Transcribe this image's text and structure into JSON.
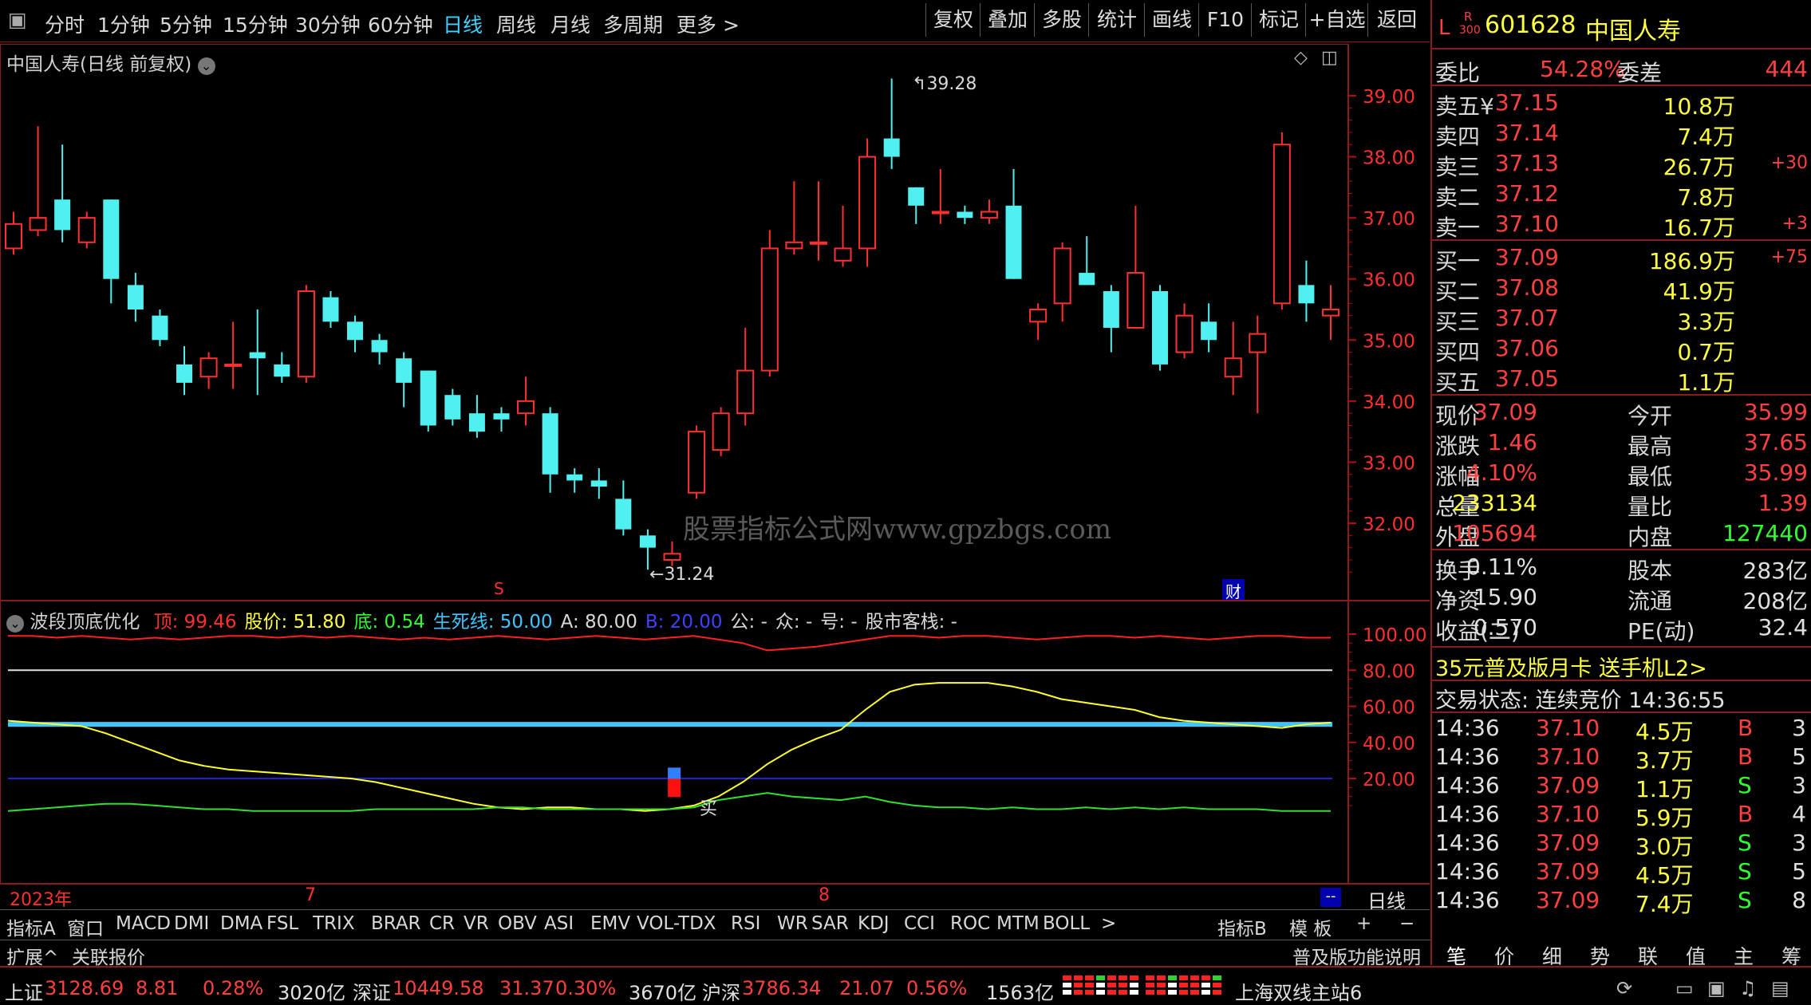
{
  "toolbar": {
    "periods": [
      "分时",
      "1分钟",
      "5分钟",
      "15分钟",
      "30分钟",
      "60分钟",
      "日线",
      "周线",
      "月线",
      "多周期",
      "更多 >"
    ],
    "active_period": "日线",
    "right_buttons": [
      "复权",
      "叠加",
      "多股",
      "统计",
      "画线",
      "F10",
      "标记",
      "+自选",
      "返回"
    ]
  },
  "chart": {
    "title": "中国人寿(日线 前复权)",
    "price_high_label": "39.28",
    "price_low_label": "31.24",
    "watermark": "股票指标公式网www.gpzbgs.com",
    "marker_s": "S",
    "marker_cai": "财",
    "price_axis": [
      "39.00",
      "38.00",
      "37.00",
      "36.00",
      "35.00",
      "34.00",
      "33.00",
      "32.00"
    ]
  },
  "indicator": {
    "name": "波段顶底优化",
    "labels": [
      {
        "text": "顶: 99.46",
        "color": "#ff3030"
      },
      {
        "text": "股价: 51.80",
        "color": "#ffff40"
      },
      {
        "text": "底: 0.54",
        "color": "#30ff30"
      },
      {
        "text": "生死线: 50.00",
        "color": "#3fc6ff"
      },
      {
        "text": "A: 80.00",
        "color": "#d8d8d8"
      },
      {
        "text": "B: 20.00",
        "color": "#4040ff"
      },
      {
        "text": "公: -",
        "color": "#d8d8d8"
      },
      {
        "text": "众: -",
        "color": "#d8d8d8"
      },
      {
        "text": "号: -",
        "color": "#d8d8d8"
      },
      {
        "text": "股市客栈: -",
        "color": "#d8d8d8"
      }
    ],
    "axis": [
      "100.00",
      "80.00",
      "60.00",
      "40.00",
      "20.00"
    ],
    "buy_label": "买"
  },
  "chart_data": {
    "type": "candlestick",
    "title": "中国人寿(日线 前复权)",
    "ylim": [
      31.5,
      39.5
    ],
    "x_labels": [
      "2023年",
      "7",
      "8"
    ],
    "candles": [
      {
        "o": 36.5,
        "c": 36.9,
        "h": 37.1,
        "l": 36.4
      },
      {
        "o": 36.8,
        "c": 37.0,
        "h": 38.5,
        "l": 36.7
      },
      {
        "o": 37.3,
        "c": 36.8,
        "h": 38.2,
        "l": 36.6
      },
      {
        "o": 36.6,
        "c": 37.0,
        "h": 37.1,
        "l": 36.5
      },
      {
        "o": 37.3,
        "c": 36.0,
        "h": 37.3,
        "l": 35.6
      },
      {
        "o": 35.9,
        "c": 35.5,
        "h": 36.1,
        "l": 35.3
      },
      {
        "o": 35.4,
        "c": 35.0,
        "h": 35.5,
        "l": 34.9
      },
      {
        "o": 34.6,
        "c": 34.3,
        "h": 34.9,
        "l": 34.1
      },
      {
        "o": 34.4,
        "c": 34.7,
        "h": 34.8,
        "l": 34.2
      },
      {
        "o": 34.6,
        "c": 34.6,
        "h": 35.3,
        "l": 34.2
      },
      {
        "o": 34.8,
        "c": 34.7,
        "h": 35.5,
        "l": 34.1
      },
      {
        "o": 34.6,
        "c": 34.4,
        "h": 34.8,
        "l": 34.3
      },
      {
        "o": 34.4,
        "c": 35.8,
        "h": 35.9,
        "l": 34.3
      },
      {
        "o": 35.7,
        "c": 35.3,
        "h": 35.8,
        "l": 35.2
      },
      {
        "o": 35.3,
        "c": 35.0,
        "h": 35.4,
        "l": 34.8
      },
      {
        "o": 35.0,
        "c": 34.8,
        "h": 35.1,
        "l": 34.6
      },
      {
        "o": 34.7,
        "c": 34.3,
        "h": 34.8,
        "l": 33.9
      },
      {
        "o": 34.5,
        "c": 33.6,
        "h": 34.5,
        "l": 33.5
      },
      {
        "o": 34.1,
        "c": 33.7,
        "h": 34.2,
        "l": 33.6
      },
      {
        "o": 33.8,
        "c": 33.5,
        "h": 34.1,
        "l": 33.4
      },
      {
        "o": 33.8,
        "c": 33.7,
        "h": 33.9,
        "l": 33.5
      },
      {
        "o": 33.8,
        "c": 34.0,
        "h": 34.4,
        "l": 33.6
      },
      {
        "o": 33.8,
        "c": 32.8,
        "h": 33.9,
        "l": 32.5
      },
      {
        "o": 32.8,
        "c": 32.7,
        "h": 32.9,
        "l": 32.5
      },
      {
        "o": 32.7,
        "c": 32.6,
        "h": 32.9,
        "l": 32.4
      },
      {
        "o": 32.4,
        "c": 31.9,
        "h": 32.7,
        "l": 31.8
      },
      {
        "o": 31.8,
        "c": 31.6,
        "h": 31.9,
        "l": 31.24
      },
      {
        "o": 31.4,
        "c": 31.5,
        "h": 31.7,
        "l": 31.3
      },
      {
        "o": 32.5,
        "c": 33.5,
        "h": 33.6,
        "l": 32.4
      },
      {
        "o": 33.2,
        "c": 33.8,
        "h": 33.9,
        "l": 33.1
      },
      {
        "o": 33.8,
        "c": 34.5,
        "h": 35.2,
        "l": 33.6
      },
      {
        "o": 34.5,
        "c": 36.5,
        "h": 36.8,
        "l": 34.4
      },
      {
        "o": 36.5,
        "c": 36.6,
        "h": 37.6,
        "l": 36.4
      },
      {
        "o": 36.6,
        "c": 36.6,
        "h": 37.6,
        "l": 36.3
      },
      {
        "o": 36.3,
        "c": 36.5,
        "h": 37.2,
        "l": 36.2
      },
      {
        "o": 36.5,
        "c": 38.0,
        "h": 38.3,
        "l": 36.2
      },
      {
        "o": 38.3,
        "c": 38.0,
        "h": 39.28,
        "l": 37.8
      },
      {
        "o": 37.5,
        "c": 37.2,
        "h": 37.5,
        "l": 36.9
      },
      {
        "o": 37.1,
        "c": 37.1,
        "h": 37.8,
        "l": 36.9
      },
      {
        "o": 37.1,
        "c": 37.0,
        "h": 37.2,
        "l": 36.9
      },
      {
        "o": 37.0,
        "c": 37.1,
        "h": 37.3,
        "l": 36.9
      },
      {
        "o": 37.2,
        "c": 36.0,
        "h": 37.8,
        "l": 36.0
      },
      {
        "o": 35.3,
        "c": 35.5,
        "h": 35.6,
        "l": 35.0
      },
      {
        "o": 35.6,
        "c": 36.5,
        "h": 36.6,
        "l": 35.3
      },
      {
        "o": 36.1,
        "c": 35.9,
        "h": 36.7,
        "l": 35.9
      },
      {
        "o": 35.8,
        "c": 35.2,
        "h": 35.9,
        "l": 34.8
      },
      {
        "o": 35.2,
        "c": 36.1,
        "h": 37.2,
        "l": 35.2
      },
      {
        "o": 35.8,
        "c": 34.6,
        "h": 35.9,
        "l": 34.5
      },
      {
        "o": 34.8,
        "c": 35.4,
        "h": 35.6,
        "l": 34.7
      },
      {
        "o": 35.3,
        "c": 35.0,
        "h": 35.6,
        "l": 34.8
      },
      {
        "o": 34.4,
        "c": 34.7,
        "h": 35.3,
        "l": 34.1
      },
      {
        "o": 34.8,
        "c": 35.1,
        "h": 35.4,
        "l": 33.8
      },
      {
        "o": 35.6,
        "c": 38.2,
        "h": 38.4,
        "l": 35.5
      },
      {
        "o": 35.9,
        "c": 35.6,
        "h": 36.3,
        "l": 35.3
      },
      {
        "o": 35.4,
        "c": 35.5,
        "h": 35.9,
        "l": 35.0
      }
    ],
    "indicator_series": {
      "ylim": [
        0,
        105
      ],
      "top_red": [
        99,
        99,
        98,
        99,
        98,
        97,
        98,
        97,
        98,
        99,
        99,
        98,
        99,
        98,
        99,
        98,
        97,
        98,
        97,
        98,
        99,
        98,
        97,
        98,
        99,
        98,
        97,
        98,
        99,
        97,
        95,
        91,
        92,
        93,
        95,
        97,
        99,
        99,
        98,
        99,
        99,
        98,
        97,
        98,
        99,
        99,
        98,
        99,
        98,
        97,
        98,
        99,
        99,
        98,
        98
      ],
      "price_yellow": [
        52,
        51,
        50,
        49,
        45,
        40,
        35,
        30,
        27,
        25,
        24,
        23,
        22,
        21,
        20,
        18,
        15,
        12,
        9,
        6,
        4,
        3,
        4,
        4,
        3,
        3,
        2,
        3,
        5,
        10,
        18,
        28,
        36,
        42,
        47,
        58,
        68,
        72,
        73,
        73,
        73,
        71,
        68,
        64,
        62,
        60,
        58,
        54,
        52,
        51,
        50,
        49,
        48,
        50,
        51
      ],
      "bottom_green": [
        2,
        3,
        4,
        5,
        6,
        6,
        5,
        4,
        3,
        3,
        2,
        2,
        2,
        2,
        2,
        3,
        3,
        3,
        3,
        3,
        4,
        4,
        3,
        3,
        3,
        3,
        3,
        3,
        4,
        8,
        10,
        12,
        10,
        9,
        8,
        10,
        7,
        5,
        4,
        4,
        3,
        4,
        3,
        3,
        4,
        3,
        4,
        3,
        4,
        3,
        3,
        3,
        2,
        2,
        2
      ],
      "A": 80,
      "B": 20,
      "shengsi": 50,
      "buy_index": 27,
      "buy_value": 26
    }
  },
  "bottom_axis": {
    "labels": [
      "2023年",
      "7",
      "8"
    ],
    "period": "日线"
  },
  "indicator_tabs": [
    "指标A",
    "窗口",
    "MACD",
    "DMI",
    "DMA",
    "FSL",
    "TRIX",
    "BRAR",
    "CR",
    "VR",
    "OBV",
    "ASI",
    "EMV",
    "VOL-TDX",
    "RSI",
    "WR",
    "SAR",
    "KDJ",
    "CCI",
    "ROC",
    "MTM",
    "BOLL",
    ">"
  ],
  "indicator_tabs_right": [
    "指标B",
    "模 板",
    "+",
    "−"
  ],
  "bar2": {
    "left": [
      "扩展^",
      "关联报价"
    ],
    "right": "普及版功能说明"
  },
  "right_panel": {
    "flag_L": "L",
    "flag_R": "R",
    "flag_300": "300",
    "code": "601628",
    "name": "中国人寿",
    "weibi_label": "委比",
    "weibi": "54.28%",
    "weicha_label": "委差",
    "weicha": "444",
    "sell": [
      {
        "label": "卖五¥",
        "price": "37.15",
        "vol": "10.8万",
        "delta": ""
      },
      {
        "label": "卖四",
        "price": "37.14",
        "vol": "7.4万",
        "delta": ""
      },
      {
        "label": "卖三",
        "price": "37.13",
        "vol": "26.7万",
        "delta": "+30"
      },
      {
        "label": "卖二",
        "price": "37.12",
        "vol": "7.8万",
        "delta": ""
      },
      {
        "label": "卖一",
        "price": "37.10",
        "vol": "16.7万",
        "delta": "+3"
      }
    ],
    "buy": [
      {
        "label": "买一",
        "price": "37.09",
        "vol": "186.9万",
        "delta": "+75"
      },
      {
        "label": "买二",
        "price": "37.08",
        "vol": "41.9万",
        "delta": ""
      },
      {
        "label": "买三",
        "price": "37.07",
        "vol": "3.3万",
        "delta": ""
      },
      {
        "label": "买四",
        "price": "37.06",
        "vol": "0.7万",
        "delta": ""
      },
      {
        "label": "买五",
        "price": "37.05",
        "vol": "1.1万",
        "delta": ""
      }
    ],
    "quotes": [
      {
        "l1": "现价",
        "v1": "37.09",
        "c1": "red",
        "l2": "今开",
        "v2": "35.99",
        "c2": "red"
      },
      {
        "l1": "涨跌",
        "v1": "1.46",
        "c1": "red",
        "l2": "最高",
        "v2": "37.65",
        "c2": "red"
      },
      {
        "l1": "涨幅",
        "v1": "4.10%",
        "c1": "red",
        "l2": "最低",
        "v2": "35.99",
        "c2": "red"
      },
      {
        "l1": "总量",
        "v1": "233134",
        "c1": "yel",
        "l2": "量比",
        "v2": "1.39",
        "c2": "red"
      },
      {
        "l1": "外盘",
        "v1": "105694",
        "c1": "red",
        "l2": "内盘",
        "v2": "127440",
        "c2": "grn"
      }
    ],
    "quotes2": [
      {
        "l1": "换手",
        "v1": "0.11%",
        "c1": "wht",
        "l2": "股本",
        "v2": "283亿",
        "c2": "wht"
      },
      {
        "l1": "净资",
        "v1": "15.90",
        "c1": "wht",
        "l2": "流通",
        "v2": "208亿",
        "c2": "wht"
      },
      {
        "l1": "收益(二)",
        "v1": "0.570",
        "c1": "wht",
        "l2": "PE(动)",
        "v2": "32.4",
        "c2": "wht"
      }
    ],
    "promo": "35元普及版月卡 送手机L2>",
    "trade_status": "交易状态: 连续竞价 14:36:55",
    "ticks": [
      {
        "t": "14:36",
        "p": "37.10",
        "v": "4.5万",
        "f": "B",
        "n": "3"
      },
      {
        "t": "14:36",
        "p": "37.10",
        "v": "3.7万",
        "f": "B",
        "n": "5"
      },
      {
        "t": "14:36",
        "p": "37.09",
        "v": "1.1万",
        "f": "S",
        "n": "3"
      },
      {
        "t": "14:36",
        "p": "37.10",
        "v": "5.9万",
        "f": "B",
        "n": "4"
      },
      {
        "t": "14:36",
        "p": "37.09",
        "v": "3.0万",
        "f": "S",
        "n": "3"
      },
      {
        "t": "14:36",
        "p": "37.09",
        "v": "4.5万",
        "f": "S",
        "n": "5"
      },
      {
        "t": "14:36",
        "p": "37.09",
        "v": "7.4万",
        "f": "S",
        "n": "8"
      }
    ],
    "tabs": [
      "笔",
      "价",
      "细",
      "势",
      "联",
      "值",
      "主",
      "筹"
    ]
  },
  "status": [
    {
      "text": "上证",
      "color": "#e0e0e0"
    },
    {
      "text": "3128.69",
      "color": "#ff4040"
    },
    {
      "text": "8.81",
      "color": "#ff4040"
    },
    {
      "text": "0.28%",
      "color": "#ff4040"
    },
    {
      "text": "3020亿",
      "color": "#e0e0e0"
    },
    {
      "text": "深证",
      "color": "#e0e0e0"
    },
    {
      "text": "10449.58",
      "color": "#ff4040"
    },
    {
      "text": "31.37",
      "color": "#ff4040"
    },
    {
      "text": "0.30%",
      "color": "#ff4040"
    },
    {
      "text": "3670亿",
      "color": "#e0e0e0"
    },
    {
      "text": "沪深",
      "color": "#e0e0e0"
    },
    {
      "text": "3786.34",
      "color": "#ff4040"
    },
    {
      "text": "21.07",
      "color": "#ff4040"
    },
    {
      "text": "0.56%",
      "color": "#ff4040"
    },
    {
      "text": "1563亿",
      "color": "#e0e0e0"
    }
  ],
  "server": "上海双线主站6",
  "colors": {
    "up": "#ff3030",
    "down": "#50f0f0",
    "axis_red": "#b01010",
    "accent": "#3fd1ff"
  }
}
